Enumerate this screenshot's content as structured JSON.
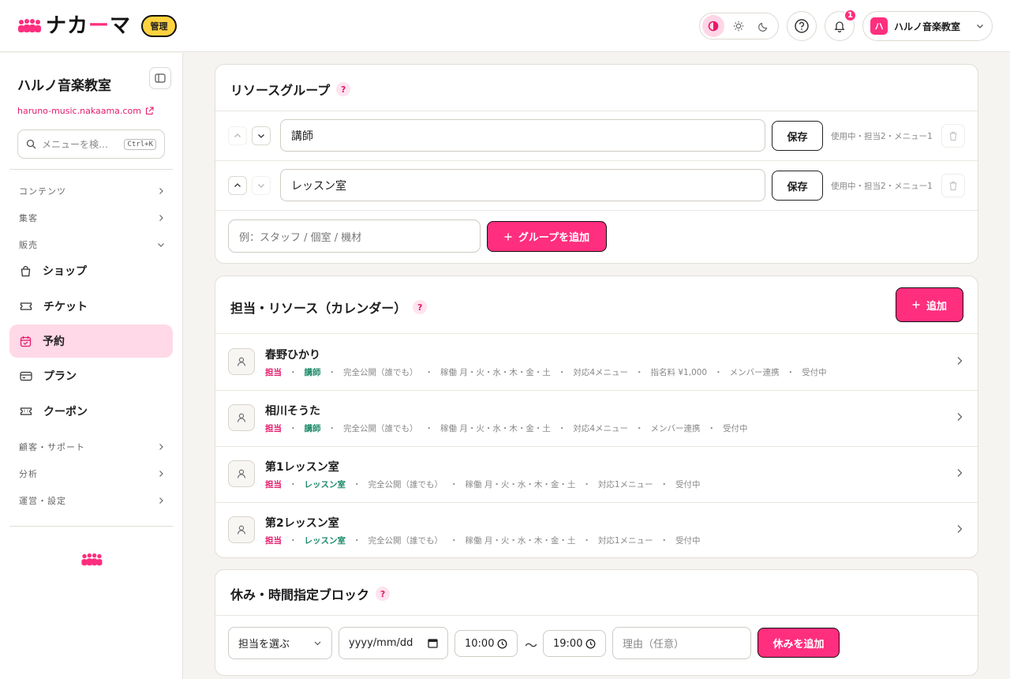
{
  "header": {
    "logo_text": "ナカーマ",
    "logo_text_a": "ナカ",
    "logo_text_dash": "ー",
    "logo_text_b": "マ",
    "admin_badge": "管理",
    "notification_count": "1",
    "account_initial": "ハ",
    "account_name": "ハルノ音楽教室"
  },
  "sidebar": {
    "shop_name": "ハルノ音楽教室",
    "shop_url": "haruno-music.nakaama.com",
    "search_placeholder": "メニューを検…",
    "search_shortcut": "Ctrl+K",
    "categories": {
      "contents": "コンテンツ",
      "marketing": "集客",
      "sales": "販売",
      "customers": "顧客・サポート",
      "analytics": "分析",
      "settings": "運営・設定"
    },
    "items": [
      {
        "label": "ショップ",
        "icon": "bag-icon"
      },
      {
        "label": "チケット",
        "icon": "ticket-icon"
      },
      {
        "label": "予約",
        "icon": "calendar-icon",
        "active": true
      },
      {
        "label": "プラン",
        "icon": "card-icon"
      },
      {
        "label": "クーポン",
        "icon": "coupon-icon"
      }
    ]
  },
  "resource_groups": {
    "title": "リソースグループ",
    "help": "?",
    "rows": [
      {
        "value": "講師",
        "save_label": "保存",
        "meta": "使用中・担当2・メニュー1"
      },
      {
        "value": "レッスン室",
        "save_label": "保存",
        "meta": "使用中・担当2・メニュー1"
      }
    ],
    "new_placeholder": "例：スタッフ / 個室 / 機材",
    "add_label": "グループを追加"
  },
  "resources": {
    "title": "担当・リソース（カレンダー）",
    "help": "?",
    "add_label": "追加",
    "items": [
      {
        "name": "春野ひかり",
        "role": "担当",
        "group": "講師",
        "meta": [
          "完全公開（誰でも）",
          "稼働 月・火・水・木・金・土",
          "対応4メニュー",
          "指名料 ¥1,000",
          "メンバー連携",
          "受付中"
        ]
      },
      {
        "name": "相川そうた",
        "role": "担当",
        "group": "講師",
        "meta": [
          "完全公開（誰でも）",
          "稼働 月・火・水・木・金・土",
          "対応4メニュー",
          "メンバー連携",
          "受付中"
        ]
      },
      {
        "name": "第1レッスン室",
        "role": "担当",
        "group": "レッスン室",
        "meta": [
          "完全公開（誰でも）",
          "稼働 月・火・水・木・金・土",
          "対応1メニュー",
          "受付中"
        ]
      },
      {
        "name": "第2レッスン室",
        "role": "担当",
        "group": "レッスン室",
        "meta": [
          "完全公開（誰でも）",
          "稼働 月・火・水・木・金・土",
          "対応1メニュー",
          "受付中"
        ]
      }
    ]
  },
  "blocks": {
    "title": "休み・時間指定ブロック",
    "help": "?",
    "staff_select": "担当を選ぶ",
    "date_placeholder": "yyyy/mm/dd",
    "start_time": "10:00",
    "tilde": "〜",
    "end_time": "19:00",
    "reason_placeholder": "理由（任意）",
    "add_label": "休みを追加"
  },
  "colors": {
    "accent": "#ff2e7e",
    "badge": "#ffd23f",
    "active_nav": "#ffd9e7",
    "tag_green": "#1f8a6a"
  }
}
